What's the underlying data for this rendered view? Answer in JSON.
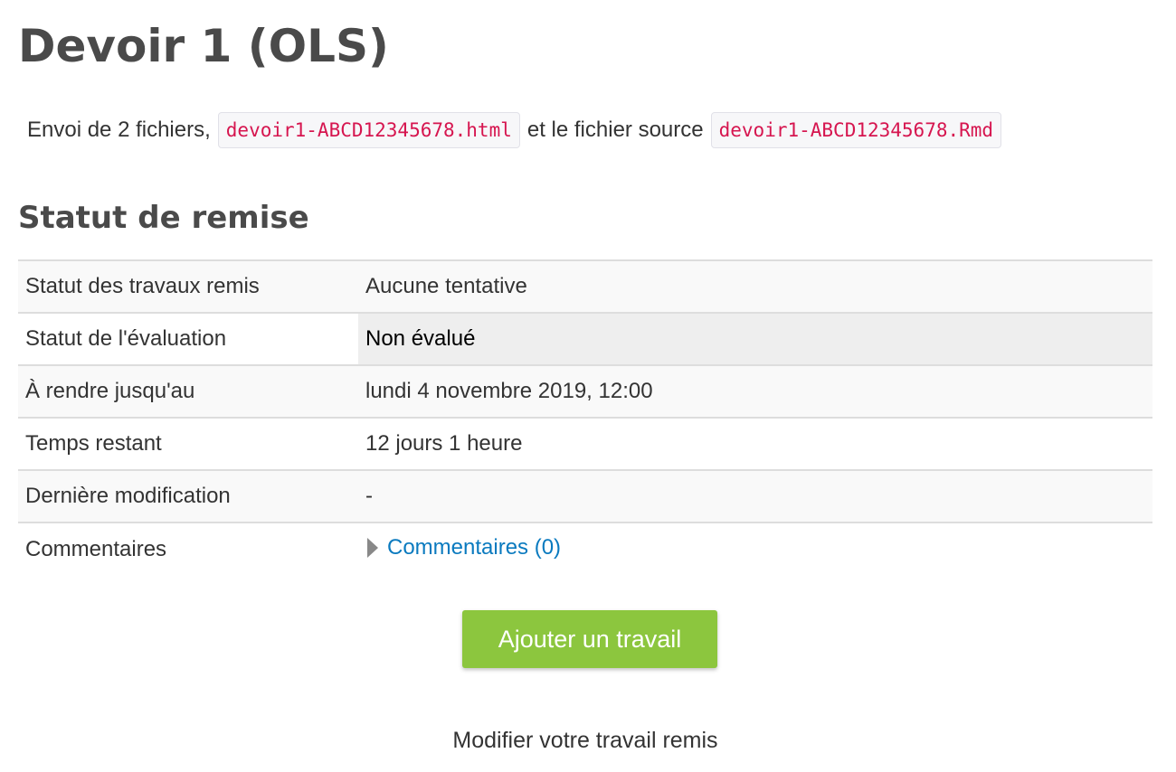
{
  "page": {
    "title": "Devoir 1 (OLS)"
  },
  "intro": {
    "prefix": "Envoi de 2 fichiers,",
    "file_html": "devoir1-ABCD12345678.html",
    "middle": "et le fichier source",
    "file_rmd": "devoir1-ABCD12345678.Rmd"
  },
  "status_section": {
    "title": "Statut de remise",
    "rows": [
      {
        "label": "Statut des travaux remis",
        "value": "Aucune tentative"
      },
      {
        "label": "Statut de l'évaluation",
        "value": "Non évalué"
      },
      {
        "label": "À rendre jusqu'au",
        "value": "lundi 4 novembre 2019, 12:00"
      },
      {
        "label": "Temps restant",
        "value": "12 jours 1 heure"
      },
      {
        "label": "Dernière modification",
        "value": "-"
      },
      {
        "label": "Commentaires",
        "value": "Commentaires (0)"
      }
    ]
  },
  "actions": {
    "add_button": "Ajouter un travail",
    "modify_text": "Modifier votre travail remis"
  },
  "colors": {
    "accent_button": "#8cc63e",
    "link": "#0a7abf",
    "code_text": "#d6154f"
  }
}
